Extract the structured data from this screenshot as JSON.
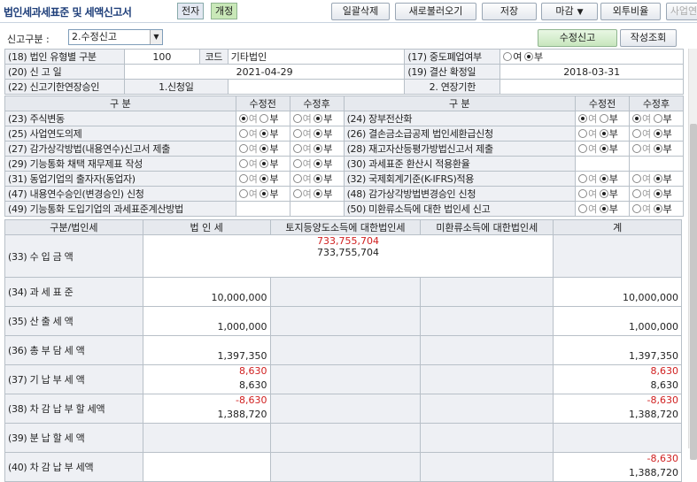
{
  "header": {
    "title": "법인세과세표준 및 세액신고서",
    "tag1": "전자",
    "tag2": "개정",
    "buttons": [
      "일괄삭제",
      "새로불러오기",
      "저장",
      "마감",
      "외투비율",
      "사업연"
    ]
  },
  "filter": {
    "label": "신고구분 :",
    "value": "2.수정신고",
    "btn_active": "수정신고",
    "btn2": "작성조회"
  },
  "info": {
    "r18_label": "(18) 법인 유형별 구분",
    "r18_code": "100",
    "r18_code_label": "코드",
    "r18_name": "기타법인",
    "r17_label": "(17) 중도폐업여부",
    "yes": "여",
    "no": "부",
    "r20_label": "(20) 신   고   일",
    "r20_value": "2021-04-29",
    "r19_label": "(19) 결산 확정일",
    "r19_value": "2018-03-31",
    "r22_label": "(22) 신고기한연장승인",
    "r22_value": "1.신청일",
    "r22_b": "2. 연장기한"
  },
  "flags": {
    "h_div": "구 분",
    "h_before": "수정전",
    "h_after": "수정후",
    "rows": [
      {
        "l": "(23) 주식변동",
        "lb": "여",
        "la": "부",
        "r": "(24) 장부전산화",
        "rb": "여",
        "ra": "여"
      },
      {
        "l": "(25) 사업연도의제",
        "lb": "부",
        "la": "부",
        "r": "(26) 결손금소급공제 법인세환급신청",
        "rb": "부",
        "ra": "부"
      },
      {
        "l": "(27) 감가상각방법(내용연수)신고서 제출",
        "lb": "부",
        "la": "부",
        "r": "(28) 재고자산등평가방법신고서 제출",
        "rb": "부",
        "ra": "부"
      },
      {
        "l": "(29) 기능통화 채택 재무제표 작성",
        "lb": "부",
        "la": "부",
        "r": "(30) 과세표준 환산시 적용환율",
        "rb": "",
        "ra": ""
      },
      {
        "l": "(31) 동업기업의 출자자(동업자)",
        "lb": "부",
        "la": "부",
        "r": "(32) 국제회계기준(K-IFRS)적용",
        "rb": "부",
        "ra": "부"
      },
      {
        "l": "(47) 내용연수승인(변경승인) 신청",
        "lb": "부",
        "la": "부",
        "r": "(48) 감가상각방법변경승인 신청",
        "rb": "부",
        "ra": "부"
      },
      {
        "l": "(49) 기능통화 도입기업의 과세표준계산방법",
        "lb": "",
        "la": "",
        "r": "(50) 미환류소득에 대한 법인세 신고",
        "rb": "부",
        "ra": "부"
      }
    ]
  },
  "tax": {
    "h": [
      "구분/법인세",
      "법 인 세",
      "토지등양도소득에 대한법인세",
      "미환류소득에 대한법인세",
      "계"
    ],
    "rows": [
      {
        "label": "(33) 수   입   금   액",
        "span": true,
        "v1": "733,755,704",
        "v2": "733,755,704"
      },
      {
        "label": "(34) 과   세   표   준",
        "a2": "10,000,000",
        "t2": "10,000,000"
      },
      {
        "label": "(35) 산   출   세   액",
        "a2": "1,000,000",
        "t2": "1,000,000"
      },
      {
        "label": "(36) 총 부 담 세 액",
        "a2": "1,397,350",
        "t2": "1,397,350"
      },
      {
        "label": "(37) 기 납 부 세 액",
        "a1": "8,630",
        "a2": "8,630",
        "t1": "8,630",
        "t2": "8,630"
      },
      {
        "label": "(38) 차 감 납 부 할 세액",
        "a1": "-8,630",
        "a2": "1,388,720",
        "t1": "-8,630",
        "t2": "1,388,720"
      },
      {
        "label": "(39) 분 납 할 세 액"
      },
      {
        "label": "(40) 차 감 납 부 세액",
        "t1": "-8,630",
        "t2": "1,388,720"
      }
    ]
  },
  "colors": {
    "accent": "#1f3f7a",
    "negative": "#d02020",
    "label_bg": "#eef0f4",
    "green_btn": "#c7e6bd"
  }
}
